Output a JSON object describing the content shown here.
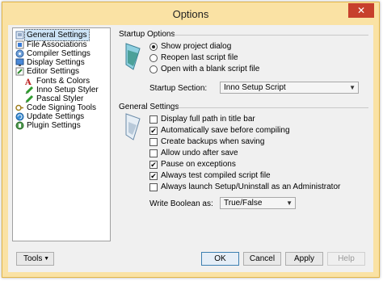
{
  "window": {
    "title": "Options",
    "close_glyph": "✕"
  },
  "tree": {
    "items": [
      {
        "label": "General Settings",
        "icon": "settings-icon",
        "selected": true
      },
      {
        "label": "File Associations",
        "icon": "file-associations-icon"
      },
      {
        "label": "Compiler Settings",
        "icon": "compiler-icon"
      },
      {
        "label": "Display Settings",
        "icon": "display-icon"
      },
      {
        "label": "Editor Settings",
        "icon": "editor-icon"
      },
      {
        "label": "Fonts & Colors",
        "icon": "fonts-colors-icon"
      },
      {
        "label": "Inno Setup Styler",
        "icon": "pencil-icon"
      },
      {
        "label": "Pascal Styler",
        "icon": "pencil-icon"
      },
      {
        "label": "Code Signing Tools",
        "icon": "code-signing-icon"
      },
      {
        "label": "Update Settings",
        "icon": "update-icon"
      },
      {
        "label": "Plugin Settings",
        "icon": "plugin-icon"
      }
    ]
  },
  "startup": {
    "heading": "Startup Options",
    "options": [
      {
        "label": "Show project dialog",
        "selected": true
      },
      {
        "label": "Reopen last script file",
        "selected": false
      },
      {
        "label": "Open with a blank script file",
        "selected": false
      }
    ],
    "section_label": "Startup Section:",
    "section_value": "Inno Setup Script"
  },
  "general": {
    "heading": "General Settings",
    "checks": [
      {
        "label": "Display full path in title bar",
        "checked": false
      },
      {
        "label": "Automatically save before compiling",
        "checked": true
      },
      {
        "label": "Create backups when saving",
        "checked": false
      },
      {
        "label": "Allow undo after save",
        "checked": false
      },
      {
        "label": "Pause on exceptions",
        "checked": true
      },
      {
        "label": "Always test compiled script file",
        "checked": true
      },
      {
        "label": "Always launch Setup/Uninstall as an Administrator",
        "checked": false
      }
    ],
    "boolean_label": "Write Boolean as:",
    "boolean_value": "True/False"
  },
  "buttons": {
    "tools": "Tools",
    "ok": "OK",
    "cancel": "Cancel",
    "apply": "Apply",
    "help": "Help"
  },
  "colors": {
    "titlebar": "#fae2a4",
    "close": "#c7402c",
    "selection": "#cde4f7"
  }
}
